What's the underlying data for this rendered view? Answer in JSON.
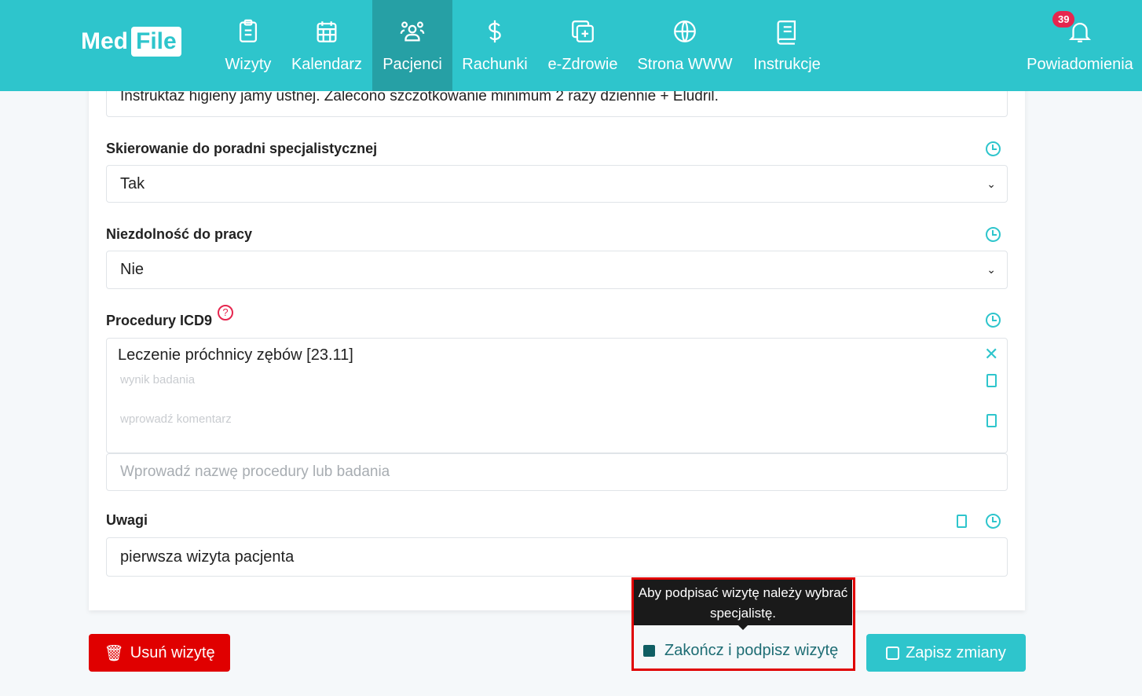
{
  "nav": {
    "logo": "MedFile",
    "logo_a": "Med",
    "logo_b": "File",
    "items": [
      {
        "label": "Wizyty",
        "icon": "clipboard-icon"
      },
      {
        "label": "Kalendarz",
        "icon": "calendar-icon"
      },
      {
        "label": "Pacjenci",
        "icon": "users-icon",
        "active": true
      },
      {
        "label": "Rachunki",
        "icon": "dollar-icon"
      },
      {
        "label": "e-Zdrowie",
        "icon": "medical-plus-icon"
      },
      {
        "label": "Strona WWW",
        "icon": "globe-icon"
      },
      {
        "label": "Instrukcje",
        "icon": "book-icon"
      }
    ],
    "notifications": {
      "label": "Powiadomienia",
      "count": "39"
    }
  },
  "form": {
    "top_text": "Instruktaż higieny jamy ustnej. Zalecono szczotkowanie minimum 2 razy dziennie + Eludril.",
    "referral": {
      "label": "Skierowanie do poradni specjalistycznej",
      "value": "Tak"
    },
    "incapacity": {
      "label": "Niezdolność do pracy",
      "value": "Nie"
    },
    "icd9": {
      "label": "Procedury ICD9",
      "help": "?",
      "item": "Leczenie próchnicy zębów [23.11]",
      "result_placeholder": "wynik badania",
      "comment_placeholder": "wprowadź komentarz",
      "search_placeholder": "Wprowadź nazwę procedury lub badania"
    },
    "notes": {
      "label": "Uwagi",
      "value": "pierwsza wizyta pacjenta"
    }
  },
  "actions": {
    "delete": "Usuń wizytę",
    "finish": "Zakończ i podpisz wizytę",
    "save": "Zapisz zmiany",
    "tooltip": "Aby podpisać wizytę należy wybrać specjalistę."
  },
  "colors": {
    "accent": "#2ec5cc",
    "danger": "#e00000"
  }
}
